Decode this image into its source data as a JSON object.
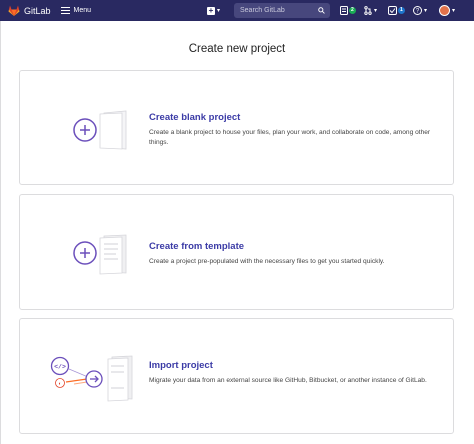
{
  "topbar": {
    "logo_text": "GitLab",
    "menu_label": "Menu",
    "search_placeholder": "Search GitLab",
    "issues_count": "2",
    "todos_count": "1",
    "colors": {
      "bg": "#292961",
      "issues_badge": "#1aaa55",
      "todos_badge": "#1f75cb"
    }
  },
  "page": {
    "title": "Create new project"
  },
  "cards": [
    {
      "title": "Create blank project",
      "description": "Create a blank project to house your files, plan your work, and collaborate on code, among other things.",
      "icon": "blank-project-icon"
    },
    {
      "title": "Create from template",
      "description": "Create a project pre-populated with the necessary files to get you started quickly.",
      "icon": "template-project-icon"
    },
    {
      "title": "Import project",
      "description": "Migrate your data from an external source like GitHub, Bitbucket, or another instance of GitLab.",
      "icon": "import-project-icon"
    }
  ]
}
